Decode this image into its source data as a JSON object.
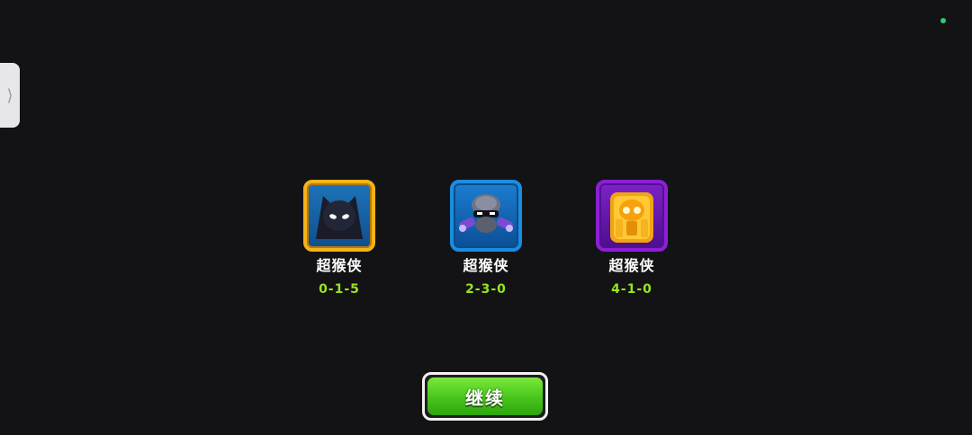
{
  "side_tab": {
    "glyph": "⟩"
  },
  "towers": [
    {
      "name": "超猴侠",
      "path": "0-1-5",
      "icon": "dark-knight-icon",
      "frame_color": "#f4b318"
    },
    {
      "name": "超猴侠",
      "path": "2-3-0",
      "icon": "robo-monkey-icon",
      "frame_color": "#1a8de0"
    },
    {
      "name": "超猴侠",
      "path": "4-1-0",
      "icon": "sun-temple-icon",
      "frame_color": "#8b1fd6"
    }
  ],
  "continue_button": {
    "label": "继续"
  },
  "colors": {
    "background": "#131316",
    "path_text": "#9be31e",
    "button_green": "#46c51b",
    "status_dot": "#2ecc71"
  }
}
